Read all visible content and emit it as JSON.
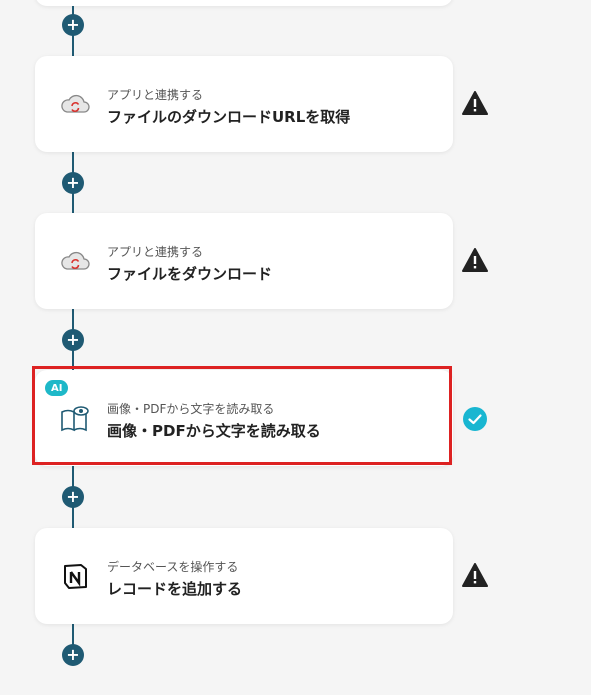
{
  "colors": {
    "connector": "#1f5a73",
    "highlight": "#dd2222",
    "ai_badge": "#1eb8c8",
    "check": "#19b6d1",
    "warning": "#222222"
  },
  "flow": {
    "add_icon": "plus-icon",
    "steps": [
      {
        "category": "アプリと連携する",
        "title": "ファイルのダウンロードURLを取得",
        "icon": "cloud-sync-icon",
        "status_icon": "warning-icon"
      },
      {
        "category": "アプリと連携する",
        "title": "ファイルをダウンロード",
        "icon": "cloud-sync-icon",
        "status_icon": "warning-icon"
      },
      {
        "badge": "AI",
        "category": "画像・PDFから文字を読み取る",
        "title": "画像・PDFから文字を読み取る",
        "icon": "ocr-book-icon",
        "status_icon": "check-circle-icon"
      },
      {
        "category": "データベースを操作する",
        "title": "レコードを追加する",
        "icon": "notion-logo-icon",
        "status_icon": "warning-icon"
      }
    ]
  }
}
